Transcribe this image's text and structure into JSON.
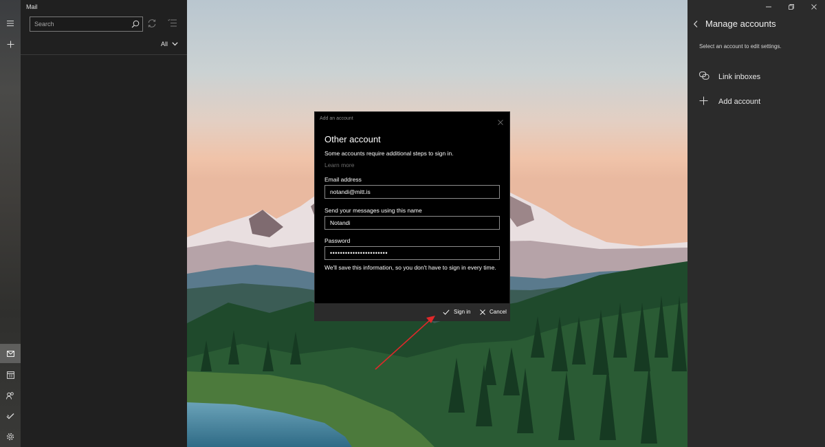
{
  "app": {
    "title": "Mail"
  },
  "rail": {
    "items": [
      {
        "icon": "hamburger-icon"
      },
      {
        "icon": "compose-plus-icon"
      },
      {
        "icon": "mail-icon"
      },
      {
        "icon": "calendar-icon"
      },
      {
        "icon": "people-icon"
      },
      {
        "icon": "todo-icon"
      },
      {
        "icon": "gear-icon"
      }
    ]
  },
  "list": {
    "search": {
      "placeholder": "Search"
    },
    "filter": {
      "selected": "All"
    }
  },
  "right_pane": {
    "title": "Manage accounts",
    "subtitle": "Select an account to edit settings.",
    "items": [
      {
        "label": "Link inboxes",
        "icon": "link-icon"
      },
      {
        "label": "Add account",
        "icon": "plus-icon"
      }
    ]
  },
  "dialog": {
    "header": "Add an account",
    "title": "Other account",
    "description": "Some accounts require additional steps to sign in.",
    "learn_more": "Learn more",
    "email": {
      "label": "Email address",
      "value": "notandi@mitt.is"
    },
    "name": {
      "label": "Send your messages using this name",
      "value": "Notandi"
    },
    "password": {
      "label": "Password",
      "value": "•••••••••••••••••••••••"
    },
    "note": "We'll save this information, so you don't have to sign in every time.",
    "sign_in": "Sign in",
    "cancel": "Cancel"
  },
  "colors": {
    "list_bg": "#202020",
    "right_bg": "#2b2b2b",
    "dialog_bg": "#000000",
    "footer_bg": "#2b2b2b",
    "arrow": "#e0282a"
  }
}
